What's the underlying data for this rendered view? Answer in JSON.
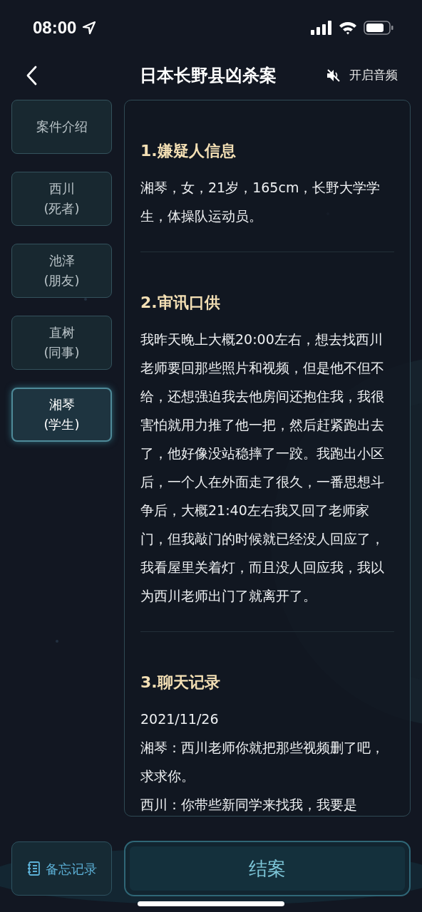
{
  "status_bar": {
    "time": "08:00"
  },
  "header": {
    "title": "日本长野县凶杀案",
    "audio": {
      "label": "开启音频",
      "muted": true
    }
  },
  "sidebar": {
    "items": [
      {
        "label": "案件介绍",
        "selected": false
      },
      {
        "label": "西川",
        "sublabel": "(死者)",
        "selected": false
      },
      {
        "label": "池泽",
        "sublabel": "(朋友)",
        "selected": false
      },
      {
        "label": "直树",
        "sublabel": "(同事)",
        "selected": false
      },
      {
        "label": "湘琴",
        "sublabel": "(学生)",
        "selected": true
      }
    ]
  },
  "content": {
    "sections": [
      {
        "title": "1.嫌疑人信息",
        "lines": [
          "湘琴，女，21岁，165cm，长野大学学生，体操队运动员。"
        ]
      },
      {
        "title": "2.审讯口供",
        "lines": [
          "我昨天晚上大概20:00左右，想去找西川老师要回那些照片和视频，但是他不但不给，还想强迫我去他房间还抱住我，我很害怕就用力推了他一把，然后赶紧跑出去了，他好像没站稳摔了一跤。我跑出小区后，一个人在外面走了很久，一番思想斗争后，大概21:40左右我又回了老师家门，但我敲门的时候就已经没人回应了，我看屋里关着灯，而且没人回应我，我以为西川老师出门了就离开了。"
        ]
      },
      {
        "title": "3.聊天记录",
        "lines": [
          "2021/11/26",
          "湘琴：西川老师你就把那些视频删了吧，求求你。",
          "西川：你带些新同学来找我，我要是"
        ]
      }
    ]
  },
  "footer": {
    "memo_button": "备忘记录",
    "close_case_button": "结案"
  }
}
